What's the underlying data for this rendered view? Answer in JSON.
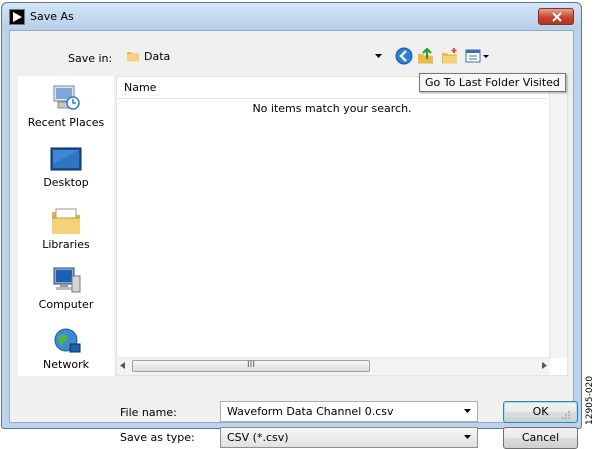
{
  "window": {
    "title": "Save As"
  },
  "save_in": {
    "label": "Save in:",
    "value": "Data"
  },
  "toolbar": {
    "back": "back-icon",
    "up": "up-folder-icon",
    "new_folder": "new-folder-icon",
    "views": "views-menu-icon"
  },
  "tooltip": "Go To Last Folder Visited",
  "places": [
    {
      "label": "Recent Places",
      "icon": "recent-places-icon"
    },
    {
      "label": "Desktop",
      "icon": "desktop-icon"
    },
    {
      "label": "Libraries",
      "icon": "libraries-icon"
    },
    {
      "label": "Computer",
      "icon": "computer-icon"
    },
    {
      "label": "Network",
      "icon": "network-icon"
    }
  ],
  "file_list": {
    "column_name": "Name",
    "empty_message": "No items match your search.",
    "scroll_thumb": "III"
  },
  "file_name": {
    "label": "File name:",
    "value": "Waveform Data Channel 0.csv"
  },
  "save_as_type": {
    "label": "Save as type:",
    "value": "CSV (*.csv)"
  },
  "buttons": {
    "ok": "OK",
    "cancel": "Cancel"
  },
  "figure_id": "12905-020",
  "colors": {
    "frame": "#bcd3ec",
    "close": "#c8442c",
    "ok_border": "#3c7fb1"
  }
}
